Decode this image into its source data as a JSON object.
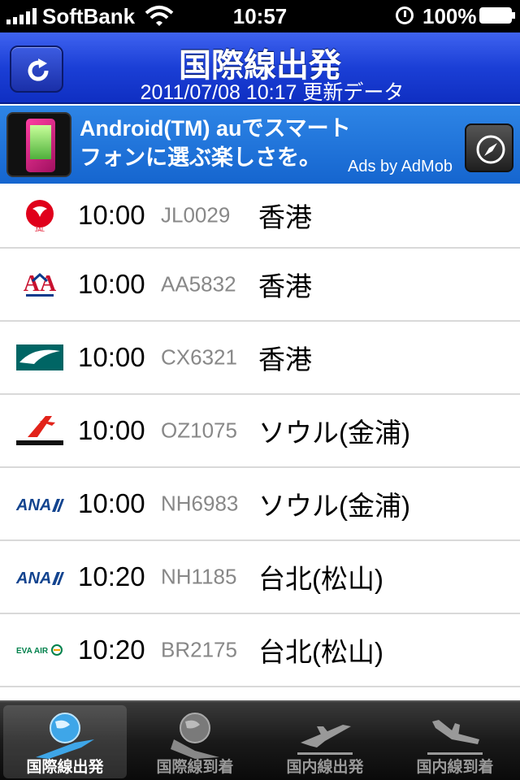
{
  "status": {
    "carrier": "SoftBank",
    "time": "10:57",
    "battery": "100%"
  },
  "nav": {
    "title": "国際線出発",
    "subtitle": "2011/07/08 10:17 更新データ",
    "refresh_icon": "refresh-icon"
  },
  "ad": {
    "line1": "Android(TM) auでスマート",
    "line2": "フォンに選ぶ楽しさを。",
    "by": "Ads by AdMob",
    "compass_icon": "compass-icon"
  },
  "flights": [
    {
      "airline_icon": "jal-logo-icon",
      "time": "10:00",
      "code": "JL0029",
      "dest": "香港"
    },
    {
      "airline_icon": "american-airlines-logo-icon",
      "time": "10:00",
      "code": "AA5832",
      "dest": "香港"
    },
    {
      "airline_icon": "cathay-pacific-logo-icon",
      "time": "10:00",
      "code": "CX6321",
      "dest": "香港"
    },
    {
      "airline_icon": "asiana-logo-icon",
      "time": "10:00",
      "code": "OZ1075",
      "dest": "ソウル(金浦)"
    },
    {
      "airline_icon": "ana-logo-icon",
      "time": "10:00",
      "code": "NH6983",
      "dest": "ソウル(金浦)"
    },
    {
      "airline_icon": "ana-logo-icon",
      "time": "10:20",
      "code": "NH1185",
      "dest": "台北(松山)"
    },
    {
      "airline_icon": "eva-air-logo-icon",
      "time": "10:20",
      "code": "BR2175",
      "dest": "台北(松山)"
    }
  ],
  "tabs": [
    {
      "label": "国際線出発",
      "icon": "globe-departure-icon",
      "active": true
    },
    {
      "label": "国際線到着",
      "icon": "globe-arrival-icon",
      "active": false
    },
    {
      "label": "国内線出発",
      "icon": "plane-departure-icon",
      "active": false
    },
    {
      "label": "国内線到着",
      "icon": "plane-arrival-icon",
      "active": false
    }
  ],
  "colors": {
    "nav_blue": "#1b3fd6",
    "ad_blue": "#1565cf",
    "tab_dark": "#1a1a1a"
  }
}
